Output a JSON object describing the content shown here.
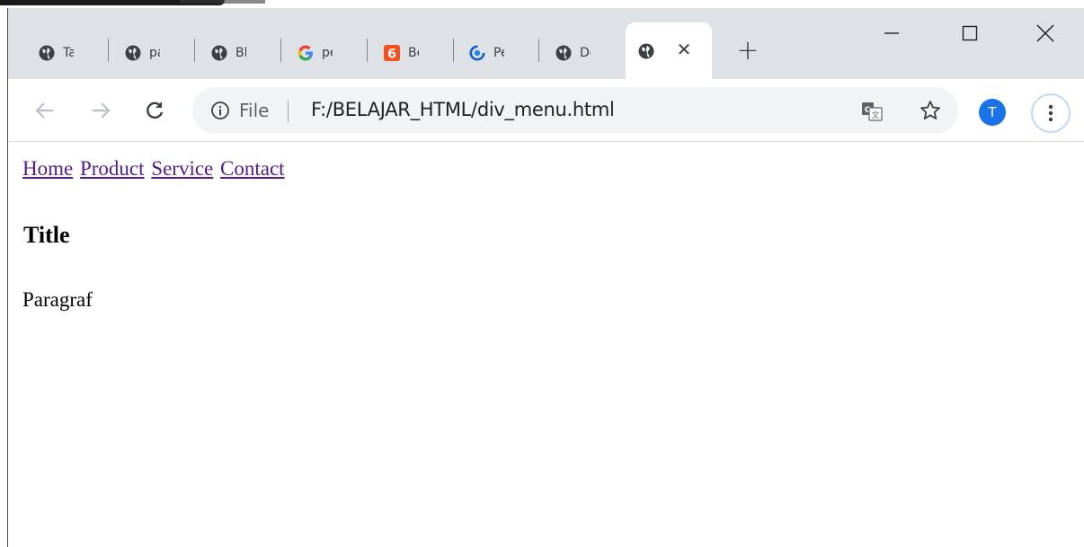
{
  "browser": {
    "tabs": [
      {
        "title": "Ta",
        "icon": "globe-icon"
      },
      {
        "title": "pa",
        "icon": "globe-icon"
      },
      {
        "title": "Bl",
        "icon": "globe-icon"
      },
      {
        "title": "pe",
        "icon": "google-icon"
      },
      {
        "title": "Be",
        "icon": "six-orange-icon"
      },
      {
        "title": "Pe",
        "icon": "blue-circle-icon"
      },
      {
        "title": "Do",
        "icon": "globe-icon"
      }
    ],
    "active_tab": {
      "icon": "globe-icon",
      "close_label": "✕"
    },
    "new_tab_label": "+",
    "window_controls": {
      "minimize": "—",
      "maximize": "☐",
      "close": "✕"
    },
    "omnibox": {
      "file_label": "File",
      "url": "F:/BELAJAR_HTML/div_menu.html"
    },
    "profile_initial": "T",
    "colors": {
      "tabstrip": "#dee1e6",
      "omnibox": "#f1f3f4",
      "avatar": "#1a73e8",
      "link": "#551a8b"
    }
  },
  "page": {
    "menu": [
      "Home",
      "Product",
      "Service",
      "Contact"
    ],
    "title": "Title",
    "paragraph": "Paragraf"
  }
}
